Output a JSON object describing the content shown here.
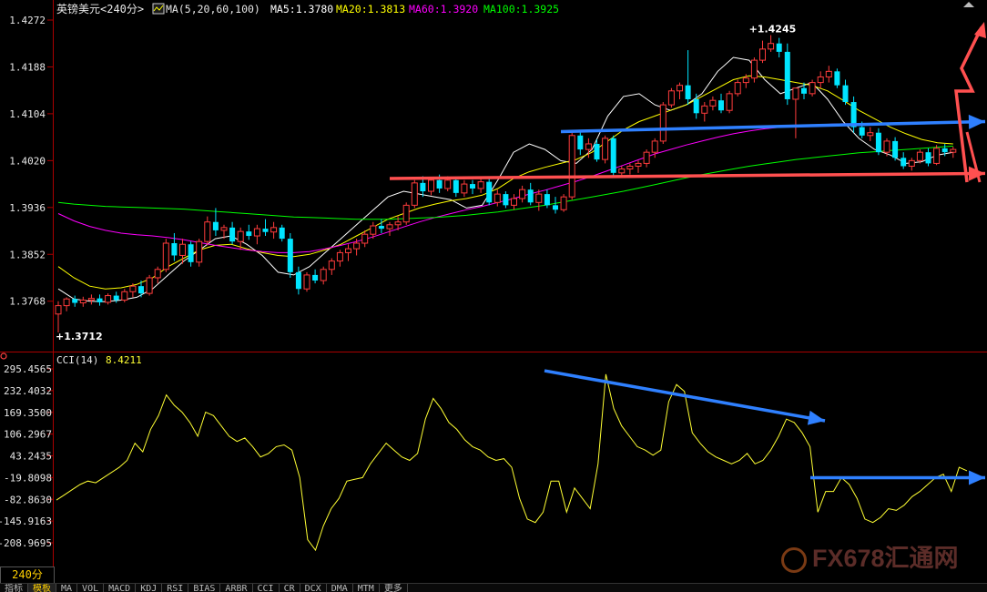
{
  "title": {
    "instrument": "英镑美元",
    "period": "<240分>",
    "ma_label": "MA(5,20,60,100)",
    "ma_values": [
      {
        "text": "MA5:1.3780",
        "color": "#ffffff"
      },
      {
        "text": "MA20:1.3813",
        "color": "#ffff00"
      },
      {
        "text": "MA60:1.3920",
        "color": "#ff00ff"
      },
      {
        "text": "MA100:1.3925",
        "color": "#00ff00"
      }
    ]
  },
  "cci_header": {
    "label": "CCI(14)",
    "value": "8.4211"
  },
  "period_button": "240分",
  "tabs": [
    "指标",
    "模板",
    "MA",
    "VOL",
    "MACD",
    "KDJ",
    "RSI",
    "BIAS",
    "ARBR",
    "CCI",
    "CR",
    "DCX",
    "DMA",
    "MTM",
    "更多"
  ],
  "watermark": "FX678汇通网",
  "colors": {
    "up": "#ff3c3c",
    "down": "#00e5ff",
    "ma5": "#ffffff",
    "ma20": "#ffff00",
    "ma60": "#ff00ff",
    "ma100": "#00ff00",
    "cci": "#ffff33",
    "axis": "#aa0000"
  },
  "chart_data": [
    {
      "type": "candlestick",
      "title": "英镑美元<240分>",
      "ylim": [
        1.3712,
        1.428
      ],
      "y_ticks": [
        "1.4272",
        "1.4188",
        "1.4104",
        "1.4020",
        "1.3936",
        "1.3852",
        "1.3768"
      ],
      "y_tick_values": [
        1.4272,
        1.4188,
        1.4104,
        1.402,
        1.3936,
        1.3852,
        1.3768
      ],
      "annotations": [
        {
          "text": "1.4245",
          "type": "high",
          "index": 77
        },
        {
          "text": "1.3712",
          "type": "low",
          "index": 0
        }
      ],
      "ohlc": [
        [
          1.3745,
          1.3768,
          1.3712,
          1.376
        ],
        [
          1.376,
          1.3775,
          1.375,
          1.3772
        ],
        [
          1.3772,
          1.3778,
          1.3758,
          1.3765
        ],
        [
          1.3765,
          1.3776,
          1.3758,
          1.377
        ],
        [
          1.377,
          1.378,
          1.3762,
          1.3773
        ],
        [
          1.3773,
          1.378,
          1.376,
          1.3766
        ],
        [
          1.3766,
          1.3782,
          1.3762,
          1.3778
        ],
        [
          1.3778,
          1.3785,
          1.3765,
          1.377
        ],
        [
          1.377,
          1.379,
          1.3766,
          1.3785
        ],
        [
          1.3785,
          1.38,
          1.3775,
          1.3795
        ],
        [
          1.3795,
          1.3805,
          1.3775,
          1.3782
        ],
        [
          1.3782,
          1.3815,
          1.3778,
          1.381
        ],
        [
          1.381,
          1.383,
          1.38,
          1.3825
        ],
        [
          1.3825,
          1.388,
          1.382,
          1.3872
        ],
        [
          1.3872,
          1.389,
          1.384,
          1.385
        ],
        [
          1.385,
          1.388,
          1.3835,
          1.387
        ],
        [
          1.387,
          1.3875,
          1.383,
          1.3838
        ],
        [
          1.3838,
          1.388,
          1.383,
          1.3875
        ],
        [
          1.3875,
          1.392,
          1.3868,
          1.391
        ],
        [
          1.391,
          1.3935,
          1.3885,
          1.3895
        ],
        [
          1.3895,
          1.3905,
          1.388,
          1.39
        ],
        [
          1.39,
          1.391,
          1.387,
          1.3875
        ],
        [
          1.3875,
          1.39,
          1.386,
          1.3893
        ],
        [
          1.3893,
          1.3905,
          1.3878,
          1.3885
        ],
        [
          1.3885,
          1.3905,
          1.387,
          1.3898
        ],
        [
          1.3898,
          1.3915,
          1.3885,
          1.3892
        ],
        [
          1.3892,
          1.391,
          1.388,
          1.39
        ],
        [
          1.39,
          1.3905,
          1.3875,
          1.388
        ],
        [
          1.388,
          1.389,
          1.381,
          1.382
        ],
        [
          1.382,
          1.383,
          1.378,
          1.379
        ],
        [
          1.379,
          1.382,
          1.3785,
          1.3815
        ],
        [
          1.3815,
          1.3825,
          1.38,
          1.3805
        ],
        [
          1.3805,
          1.383,
          1.3798,
          1.3825
        ],
        [
          1.3825,
          1.3845,
          1.3815,
          1.384
        ],
        [
          1.384,
          1.386,
          1.383,
          1.3855
        ],
        [
          1.3855,
          1.387,
          1.384,
          1.3862
        ],
        [
          1.3862,
          1.388,
          1.385,
          1.3872
        ],
        [
          1.3872,
          1.3895,
          1.3865,
          1.3888
        ],
        [
          1.3888,
          1.391,
          1.388,
          1.3903
        ],
        [
          1.3903,
          1.3915,
          1.389,
          1.3898
        ],
        [
          1.3898,
          1.391,
          1.3885,
          1.3905
        ],
        [
          1.3905,
          1.392,
          1.3895,
          1.391
        ],
        [
          1.391,
          1.3945,
          1.3905,
          1.394
        ],
        [
          1.394,
          1.3985,
          1.3935,
          1.398
        ],
        [
          1.398,
          1.3992,
          1.3955,
          1.3965
        ],
        [
          1.3965,
          1.399,
          1.3958,
          1.3985
        ],
        [
          1.3985,
          1.3995,
          1.3962,
          1.397
        ],
        [
          1.397,
          1.3992,
          1.3965,
          1.3985
        ],
        [
          1.3985,
          1.399,
          1.3955,
          1.3962
        ],
        [
          1.3962,
          1.3985,
          1.3955,
          1.3978
        ],
        [
          1.3978,
          1.3985,
          1.396,
          1.397
        ],
        [
          1.397,
          1.3988,
          1.3962,
          1.3982
        ],
        [
          1.3982,
          1.399,
          1.394,
          1.3945
        ],
        [
          1.3945,
          1.3968,
          1.3938,
          1.396
        ],
        [
          1.396,
          1.3965,
          1.3935,
          1.394
        ],
        [
          1.394,
          1.396,
          1.3932,
          1.3952
        ],
        [
          1.3952,
          1.3975,
          1.3945,
          1.3968
        ],
        [
          1.3968,
          1.398,
          1.394,
          1.3945
        ],
        [
          1.3945,
          1.3968,
          1.393,
          1.396
        ],
        [
          1.396,
          1.3968,
          1.3935,
          1.394
        ],
        [
          1.394,
          1.3955,
          1.3925,
          1.3932
        ],
        [
          1.3932,
          1.396,
          1.3928,
          1.3955
        ],
        [
          1.3955,
          1.4072,
          1.395,
          1.4065
        ],
        [
          1.4065,
          1.4075,
          1.403,
          1.404
        ],
        [
          1.404,
          1.406,
          1.4025,
          1.405
        ],
        [
          1.405,
          1.4058,
          1.4018,
          1.4022
        ],
        [
          1.4022,
          1.4065,
          1.4015,
          1.406
        ],
        [
          1.406,
          1.4065,
          1.399,
          1.3998
        ],
        [
          1.3998,
          1.401,
          1.399,
          1.4005
        ],
        [
          1.4005,
          1.4015,
          1.3995,
          1.401
        ],
        [
          1.401,
          1.402,
          1.3998,
          1.4015
        ],
        [
          1.4015,
          1.404,
          1.4008,
          1.4035
        ],
        [
          1.4035,
          1.406,
          1.4025,
          1.4055
        ],
        [
          1.4055,
          1.4125,
          1.405,
          1.412
        ],
        [
          1.412,
          1.415,
          1.4115,
          1.4145
        ],
        [
          1.4145,
          1.416,
          1.413,
          1.4155
        ],
        [
          1.4155,
          1.4218,
          1.412,
          1.413
        ],
        [
          1.413,
          1.414,
          1.4095,
          1.4105
        ]
      ],
      "ohlc_note": "approx.",
      "ohlc_late": [
        [
          1.4105,
          1.4125,
          1.409,
          1.4118
        ],
        [
          1.4118,
          1.4135,
          1.411,
          1.4128
        ],
        [
          1.4128,
          1.414,
          1.4105,
          1.411
        ],
        [
          1.411,
          1.4145,
          1.4105,
          1.414
        ],
        [
          1.414,
          1.4165,
          1.4135,
          1.416
        ],
        [
          1.416,
          1.4175,
          1.415,
          1.4168
        ],
        [
          1.4168,
          1.4205,
          1.416,
          1.42
        ],
        [
          1.42,
          1.4235,
          1.4195,
          1.422
        ],
        [
          1.422,
          1.4245,
          1.4215,
          1.423
        ],
        [
          1.423,
          1.424,
          1.4205,
          1.4215
        ],
        [
          1.4215,
          1.423,
          1.412,
          1.413
        ],
        [
          1.413,
          1.4145,
          1.406,
          1.415
        ],
        [
          1.415,
          1.416,
          1.413,
          1.414
        ],
        [
          1.414,
          1.4165,
          1.4135,
          1.416
        ],
        [
          1.416,
          1.418,
          1.415,
          1.417
        ],
        [
          1.417,
          1.419,
          1.416,
          1.418
        ],
        [
          1.418,
          1.4185,
          1.415,
          1.4155
        ],
        [
          1.4155,
          1.4165,
          1.412,
          1.4125
        ],
        [
          1.4125,
          1.4135,
          1.407,
          1.408
        ],
        [
          1.408,
          1.409,
          1.406,
          1.4065
        ],
        [
          1.4065,
          1.408,
          1.4055,
          1.407
        ],
        [
          1.407,
          1.4078,
          1.403,
          1.4035
        ],
        [
          1.4035,
          1.406,
          1.4028,
          1.4055
        ],
        [
          1.4055,
          1.4062,
          1.402,
          1.4025
        ],
        [
          1.4025,
          1.4035,
          1.4005,
          1.401
        ],
        [
          1.401,
          1.4025,
          1.4002,
          1.402
        ],
        [
          1.402,
          1.404,
          1.4015,
          1.4035
        ],
        [
          1.4035,
          1.4042,
          1.401,
          1.4015
        ],
        [
          1.4015,
          1.4048,
          1.4012,
          1.4042
        ],
        [
          1.4042,
          1.405,
          1.4028,
          1.4035
        ],
        [
          1.4035,
          1.4045,
          1.4025,
          1.404
        ]
      ],
      "ma_lines": {
        "MA5": [
          1.379,
          1.3772,
          1.3768,
          1.3767,
          1.377,
          1.3775,
          1.379,
          1.3815,
          1.384,
          1.386,
          1.388,
          1.3885,
          1.387,
          1.385,
          1.382,
          1.3815,
          1.383,
          1.3855,
          1.388,
          1.3905,
          1.393,
          1.3955,
          1.3965,
          1.396,
          1.3955,
          1.395,
          1.3935,
          1.394,
          1.3985,
          1.4035,
          1.405,
          1.404,
          1.402,
          1.4015,
          1.404,
          1.41,
          1.4135,
          1.414,
          1.412,
          1.411,
          1.412,
          1.414,
          1.418,
          1.4205,
          1.42,
          1.4165,
          1.414,
          1.415,
          1.416,
          1.413,
          1.409,
          1.406,
          1.404,
          1.403,
          1.4015,
          1.4018,
          1.403,
          1.4035
        ],
        "MA20": [
          1.383,
          1.381,
          1.3795,
          1.379,
          1.3792,
          1.3798,
          1.381,
          1.383,
          1.3845,
          1.386,
          1.3868,
          1.387,
          1.3862,
          1.3855,
          1.385,
          1.3848,
          1.3852,
          1.386,
          1.387,
          1.3885,
          1.39,
          1.3915,
          1.3925,
          1.3935,
          1.3942,
          1.3948,
          1.3952,
          1.3958,
          1.397,
          1.3988,
          1.4,
          1.4008,
          1.4015,
          1.4022,
          1.4035,
          1.4055,
          1.4075,
          1.409,
          1.41,
          1.411,
          1.412,
          1.4135,
          1.415,
          1.4165,
          1.4172,
          1.417,
          1.4165,
          1.416,
          1.4155,
          1.4145,
          1.4128,
          1.411,
          1.4095,
          1.408,
          1.4068,
          1.4058,
          1.4052,
          1.405
        ],
        "MA60": [
          1.3925,
          1.3912,
          1.3902,
          1.3895,
          1.389,
          1.3887,
          1.3885,
          1.3882,
          1.3878,
          1.3873,
          1.3868,
          1.3864,
          1.386,
          1.3857,
          1.3855,
          1.3855,
          1.3857,
          1.3862,
          1.3868,
          1.3875,
          1.3883,
          1.3892,
          1.3901,
          1.391,
          1.3918,
          1.3925,
          1.3932,
          1.3938,
          1.3945,
          1.3952,
          1.396,
          1.3967,
          1.3975,
          1.3983,
          1.3992,
          1.4002,
          1.4012,
          1.4022,
          1.4032,
          1.404,
          1.4048,
          1.4055,
          1.4062,
          1.4068,
          1.4073,
          1.4077,
          1.408,
          1.4082,
          1.4084,
          1.4085,
          1.4086,
          1.4086,
          1.4086,
          1.4086,
          1.4086,
          1.4086,
          1.4087,
          1.4088
        ],
        "MA100": [
          1.3945,
          1.3942,
          1.394,
          1.3938,
          1.3937,
          1.3936,
          1.3935,
          1.3934,
          1.3933,
          1.3931,
          1.3929,
          1.3927,
          1.3925,
          1.3923,
          1.3921,
          1.3919,
          1.3918,
          1.3917,
          1.3916,
          1.3915,
          1.3915,
          1.3915,
          1.3916,
          1.3917,
          1.3918,
          1.392,
          1.3922,
          1.3925,
          1.3928,
          1.3932,
          1.3936,
          1.394,
          1.3945,
          1.395,
          1.3955,
          1.396,
          1.3965,
          1.3971,
          1.3977,
          1.3983,
          1.3989,
          1.3995,
          1.4,
          1.4005,
          1.401,
          1.4014,
          1.4018,
          1.4022,
          1.4025,
          1.4028,
          1.4031,
          1.4034,
          1.4036,
          1.4038,
          1.404,
          1.4042,
          1.4044,
          1.4046
        ]
      },
      "trendlines": [
        {
          "color": "#ff5050",
          "from": [
            37.5,
            1.3988
          ],
          "to": [
            108,
            1.3997
          ],
          "arrow": true
        },
        {
          "color": "#2f80ff",
          "from": [
            57,
            1.4072
          ],
          "to": [
            108,
            1.409
          ],
          "arrow": true
        }
      ]
    },
    {
      "type": "line",
      "title": "CCI(14)",
      "ylim": [
        -240,
        310
      ],
      "y_ticks": [
        "295.4565",
        "232.4032",
        "169.3500",
        "106.2967",
        "43.2435",
        "-19.8098",
        "-82.8630",
        "-145.9163",
        "-208.9695"
      ],
      "y_tick_values": [
        295.4565,
        232.4032,
        169.35,
        106.2967,
        43.2435,
        -19.8098,
        -82.863,
        -145.9163,
        -208.9695
      ],
      "series": [
        {
          "values": [
            -85,
            -70,
            -55,
            -40,
            -30,
            -35,
            -20,
            -5,
            10,
            30,
            80,
            55,
            120,
            160,
            220,
            190,
            170,
            140,
            100,
            170,
            160,
            130,
            100,
            85,
            95,
            70,
            40,
            50,
            70,
            75,
            60,
            -20,
            -200,
            -230,
            -160,
            -110,
            -80,
            -30,
            -25,
            -20,
            20,
            50,
            80,
            60,
            40,
            30,
            50,
            150,
            210,
            180,
            140,
            120,
            90,
            70,
            60,
            40,
            30,
            35,
            10,
            -80,
            -140,
            -150,
            -120,
            -30,
            -30,
            -120,
            -50,
            -80,
            -110,
            20,
            280,
            180,
            130,
            100,
            70,
            60,
            45,
            60,
            200,
            250,
            230,
            110,
            80,
            55,
            40,
            30,
            20,
            30,
            50,
            20,
            30,
            60,
            100,
            150,
            140,
            110,
            70,
            -120,
            -60,
            -60,
            -20,
            -40,
            -80,
            -140,
            -150,
            -135,
            -110,
            -115,
            -100,
            -75,
            -60,
            -40,
            -20,
            -10,
            -60,
            10,
            0
          ]
        }
      ],
      "trendlines": [
        {
          "color": "#2f80ff",
          "from": [
            60,
            290
          ],
          "to": [
            90,
            145
          ],
          "arrow": true
        },
        {
          "color": "#2f80ff",
          "from": [
            90,
            -20
          ],
          "to": [
            109,
            -20
          ],
          "arrow": true
        }
      ]
    }
  ]
}
